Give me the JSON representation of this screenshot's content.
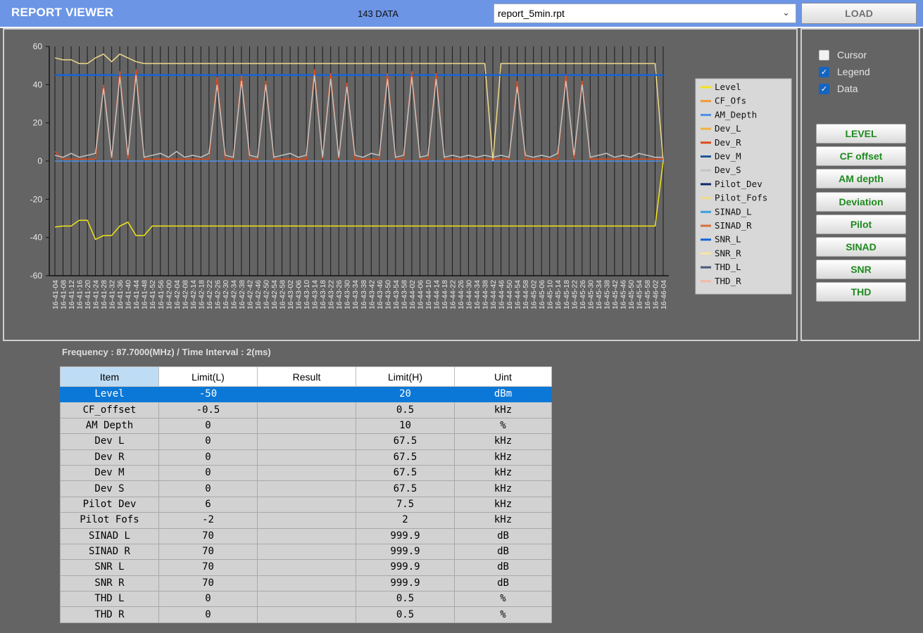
{
  "app": {
    "title": "REPORT VIEWER",
    "data_count": "143 DATA"
  },
  "file_select": {
    "value": "report_5min.rpt"
  },
  "toolbar": {
    "load_label": "LOAD"
  },
  "options": [
    {
      "label": "Cursor",
      "checked": false
    },
    {
      "label": "Legend",
      "checked": true
    },
    {
      "label": "Data",
      "checked": true
    }
  ],
  "side_buttons": [
    "LEVEL",
    "CF offset",
    "AM depth",
    "Deviation",
    "Pilot",
    "SINAD",
    "SNR",
    "THD"
  ],
  "info": {
    "frequency_line": "Frequency : 87.7000(MHz) / Time Interval : 2(ms)"
  },
  "table": {
    "headers": [
      "Item",
      "Limit(L)",
      "Result",
      "Limit(H)",
      "Uint"
    ],
    "rows": [
      [
        "Level",
        "-50",
        "",
        "20",
        "dBm"
      ],
      [
        "CF_offset",
        "-0.5",
        "",
        "0.5",
        "kHz"
      ],
      [
        "AM Depth",
        "0",
        "",
        "10",
        "%"
      ],
      [
        "Dev L",
        "0",
        "",
        "67.5",
        "kHz"
      ],
      [
        "Dev R",
        "0",
        "",
        "67.5",
        "kHz"
      ],
      [
        "Dev M",
        "0",
        "",
        "67.5",
        "kHz"
      ],
      [
        "Dev S",
        "0",
        "",
        "67.5",
        "kHz"
      ],
      [
        "Pilot Dev",
        "6",
        "",
        "7.5",
        "kHz"
      ],
      [
        "Pilot Fofs",
        "-2",
        "",
        "2",
        "kHz"
      ],
      [
        "SINAD L",
        "70",
        "",
        "999.9",
        "dB"
      ],
      [
        "SINAD R",
        "70",
        "",
        "999.9",
        "dB"
      ],
      [
        "SNR L",
        "70",
        "",
        "999.9",
        "dB"
      ],
      [
        "SNR R",
        "70",
        "",
        "999.9",
        "dB"
      ],
      [
        "THD L",
        "0",
        "",
        "0.5",
        "%"
      ],
      [
        "THD R",
        "0",
        "",
        "0.5",
        "%"
      ]
    ]
  },
  "chart_data": {
    "type": "line",
    "ylim": [
      -60,
      60
    ],
    "yticks": [
      60,
      40,
      20,
      0,
      -20,
      -40,
      -60
    ],
    "x_labels": [
      "16-41-04",
      "16-41-08",
      "16-41-12",
      "16-41-16",
      "16-41-20",
      "16-41-24",
      "16-41-28",
      "16-41-32",
      "16-41-36",
      "16-41-40",
      "16-41-44",
      "16-41-48",
      "16-41-52",
      "16-41-56",
      "16-42-00",
      "16-42-04",
      "16-42-08",
      "16-42-14",
      "16-42-18",
      "16-42-22",
      "16-42-26",
      "16-42-30",
      "16-42-34",
      "16-42-38",
      "16-42-42",
      "16-42-46",
      "16-42-50",
      "16-42-54",
      "16-42-58",
      "16-43-02",
      "16-43-06",
      "16-43-10",
      "16-43-14",
      "16-43-18",
      "16-43-22",
      "16-43-26",
      "16-43-30",
      "16-43-34",
      "16-43-38",
      "16-43-42",
      "16-43-46",
      "16-43-50",
      "16-43-54",
      "16-43-58",
      "16-44-02",
      "16-44-06",
      "16-44-10",
      "16-44-14",
      "16-44-18",
      "16-44-22",
      "16-44-26",
      "16-44-30",
      "16-44-34",
      "16-44-38",
      "16-44-42",
      "16-44-46",
      "16-44-50",
      "16-44-54",
      "16-44-58",
      "16-45-02",
      "16-45-06",
      "16-45-10",
      "16-45-14",
      "16-45-18",
      "16-45-22",
      "16-45-26",
      "16-45-30",
      "16-45-34",
      "16-45-38",
      "16-45-42",
      "16-45-46",
      "16-45-50",
      "16-45-54",
      "16-45-58",
      "16-46-02",
      "16-46-04"
    ],
    "legend": [
      "Level",
      "CF_Ofs",
      "AM_Depth",
      "Dev_L",
      "Dev_R",
      "Dev_M",
      "Dev_S",
      "Pilot_Dev",
      "Pilot_Fofs",
      "SINAD_L",
      "SINAD_R",
      "SNR_L",
      "SNR_R",
      "THD_L",
      "THD_R"
    ],
    "colors": [
      "#f2e416",
      "#f29a2e",
      "#4f8fe8",
      "#f2b13d",
      "#e04a1a",
      "#1f5a96",
      "#c4c4c4",
      "#0d2a6b",
      "#f0d98a",
      "#3aa0e0",
      "#d4703a",
      "#1565d8",
      "#f7e6a0",
      "#485a78",
      "#f4b9a4"
    ],
    "series": [
      {
        "name": "Level",
        "values": [
          -34.5,
          -34,
          -34,
          -31,
          -31,
          -41,
          -39,
          -39,
          -34,
          -32,
          -39,
          -39,
          -34,
          -34,
          -34,
          -34,
          -34,
          -34,
          -34,
          -34,
          -34,
          -34,
          -34,
          -34,
          -34,
          -34,
          -34,
          -34,
          -34,
          -34,
          -34,
          -34,
          -34,
          -34,
          -34,
          -34,
          -34,
          -34,
          -34,
          -34,
          -34,
          -34,
          -34,
          -34,
          -34,
          -34,
          -34,
          -34,
          -34,
          -34,
          -34,
          -34,
          -34,
          -34,
          -34,
          -34,
          -34,
          -34,
          -34,
          -34,
          -34,
          -34,
          -34,
          -34,
          -34,
          -34,
          -34,
          -34,
          -34,
          -34,
          -34,
          -34,
          -34,
          -34,
          -34,
          0
        ]
      },
      {
        "name": "Pilot_Fofs",
        "values": [
          54,
          53,
          53,
          51,
          51,
          54,
          56,
          52,
          56,
          54,
          52,
          51,
          51,
          51,
          51,
          51,
          51,
          51,
          51,
          51,
          51,
          51,
          51,
          51,
          51,
          51,
          51,
          51,
          51,
          51,
          51,
          51,
          51,
          51,
          51,
          51,
          51,
          51,
          51,
          51,
          51,
          51,
          51,
          51,
          51,
          51,
          51,
          51,
          51,
          51,
          51,
          51,
          51,
          51,
          0,
          51,
          51,
          51,
          51,
          51,
          51,
          51,
          51,
          51,
          51,
          51,
          51,
          51,
          51,
          51,
          51,
          51,
          51,
          51,
          51,
          0
        ]
      },
      {
        "name": "SNR_L",
        "values": [
          45,
          45,
          45,
          45,
          45,
          45,
          45,
          45,
          45,
          45,
          45,
          45,
          45,
          45,
          45,
          45,
          45,
          45,
          45,
          45,
          45,
          45,
          45,
          45,
          45,
          45,
          45,
          45,
          45,
          45,
          45,
          45,
          45,
          45,
          45,
          45,
          45,
          45,
          45,
          45,
          45,
          45,
          45,
          45,
          45,
          45,
          45,
          45,
          45,
          45,
          45,
          45,
          45,
          45,
          45,
          45,
          45,
          45,
          45,
          45,
          45,
          45,
          45,
          45,
          45,
          45,
          45,
          45,
          45,
          45,
          45,
          45,
          45,
          45,
          45,
          45
        ]
      },
      {
        "name": "Dev_R",
        "values": [
          5,
          1,
          1,
          1,
          1,
          1,
          40,
          1,
          47,
          1,
          48,
          1,
          1,
          1,
          1,
          1,
          1,
          1,
          1,
          1,
          44,
          1,
          1,
          45,
          1,
          1,
          42,
          1,
          1,
          1,
          1,
          1,
          48,
          1,
          46,
          1,
          41,
          1,
          1,
          1,
          1,
          46,
          1,
          1,
          47,
          1,
          1,
          46,
          1,
          1,
          1,
          1,
          1,
          1,
          1,
          1,
          1,
          42,
          1,
          1,
          1,
          1,
          1,
          45,
          1,
          42,
          1,
          1,
          1,
          1,
          1,
          1,
          1,
          1,
          1,
          1
        ]
      },
      {
        "name": "Dev_S",
        "values": [
          3,
          2,
          4,
          2,
          3,
          4,
          38,
          2,
          44,
          3,
          45,
          2,
          3,
          4,
          2,
          5,
          2,
          3,
          2,
          4,
          40,
          3,
          2,
          42,
          3,
          2,
          40,
          2,
          3,
          4,
          2,
          3,
          45,
          2,
          43,
          2,
          39,
          3,
          2,
          4,
          3,
          43,
          2,
          3,
          44,
          2,
          3,
          43,
          2,
          3,
          2,
          3,
          2,
          3,
          2,
          3,
          2,
          39,
          3,
          2,
          3,
          2,
          4,
          42,
          3,
          40,
          2,
          3,
          4,
          2,
          3,
          2,
          4,
          3,
          2,
          2
        ]
      },
      {
        "name": "AM_Depth",
        "values": [
          0,
          0,
          0,
          0,
          0,
          0,
          0,
          0,
          0,
          0,
          0,
          0,
          0,
          0,
          0,
          0,
          0,
          0,
          0,
          0,
          0,
          0,
          0,
          0,
          0,
          0,
          0,
          0,
          0,
          0,
          0,
          0,
          0,
          0,
          0,
          0,
          0,
          0,
          0,
          0,
          0,
          0,
          0,
          0,
          0,
          0,
          0,
          0,
          0,
          0,
          0,
          0,
          0,
          0,
          0,
          0,
          0,
          0,
          0,
          0,
          0,
          0,
          0,
          0,
          0,
          0,
          0,
          0,
          0,
          0,
          0,
          0,
          0,
          0,
          0,
          0
        ]
      }
    ]
  }
}
